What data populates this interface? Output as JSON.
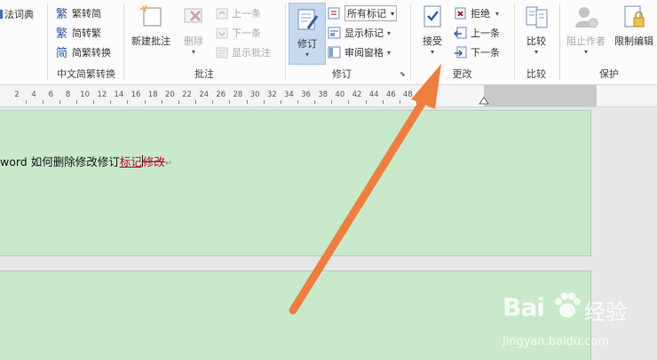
{
  "ribbon": {
    "dict_label": "法词典",
    "groups": {
      "chinese_convert": {
        "label": "中文简繁转换",
        "items": [
          "繁转简",
          "简转繁",
          "简繁转换"
        ]
      },
      "comments": {
        "label": "批注",
        "new_comment": "新建批注",
        "delete": "删除",
        "prev": "上一条",
        "next": "下一条",
        "show_comments": "显示批注"
      },
      "tracking": {
        "label": "修订",
        "track_changes": "修订",
        "markup_select": "所有标记",
        "show_markup": "显示标记",
        "reviewing_pane": "审阅窗格"
      },
      "changes": {
        "label": "更改",
        "accept": "接受",
        "reject": "拒绝",
        "prev": "上一条",
        "next": "下一条"
      },
      "compare": {
        "label": "比较",
        "compare": "比较"
      },
      "protect": {
        "label": "保护",
        "block_authors": "阻止作者",
        "restrict_editing": "限制编辑"
      }
    }
  },
  "ruler": {
    "numbers": [
      "2",
      "4",
      "6",
      "8",
      "10",
      "12",
      "14",
      "16",
      "18",
      "20",
      "22",
      "24",
      "26",
      "28",
      "30",
      "32",
      "34",
      "36",
      "38",
      "40",
      "42",
      "44",
      "46",
      "48"
    ]
  },
  "document": {
    "text_normal": "word 如何删除修改修订",
    "text_inserted": "标记",
    "text_deleted": "修改"
  },
  "watermark": {
    "brand": "Bai",
    "brand2": "经验",
    "url": "jingyan.baidu.com"
  },
  "colors": {
    "page_bg": "#c8eacb",
    "accent_orange": "#f07d3c",
    "revision_red": "#c0002a"
  }
}
